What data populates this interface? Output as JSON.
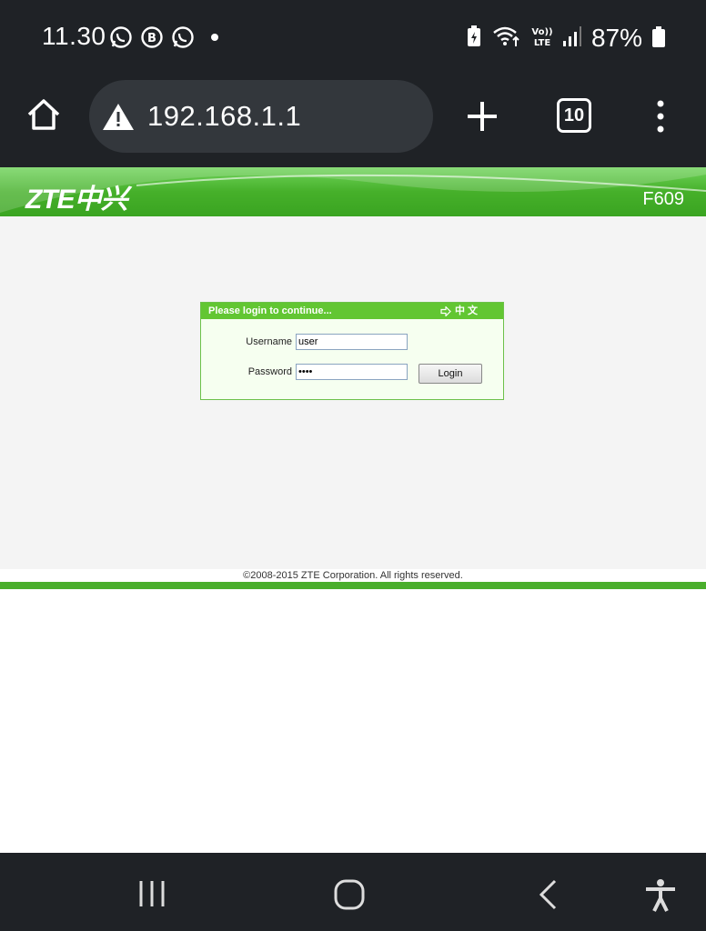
{
  "status_bar": {
    "time": "11.30",
    "app_icons": [
      "whatsapp-icon",
      "whatsapp-business-icon",
      "whatsapp-icon"
    ],
    "battery_percent": "87%",
    "network": "Vo) LTE"
  },
  "browser": {
    "url": "192.168.1.1",
    "tab_count": "10"
  },
  "router": {
    "brand": "ZTE中兴",
    "model": "F609",
    "login": {
      "header": "Please login to continue...",
      "language_link": "中 文",
      "username_label": "Username",
      "username_value": "user",
      "password_label": "Password",
      "password_value": "••••",
      "login_button": "Login"
    },
    "copyright": "©2008-2015 ZTE Corporation. All rights reserved."
  },
  "colors": {
    "brand_green": "#46b02a",
    "status_bg": "#1f2226"
  }
}
